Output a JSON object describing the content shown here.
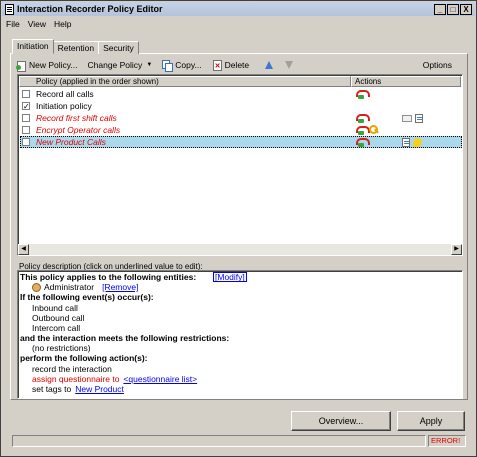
{
  "window": {
    "title": "Interaction Recorder Policy Editor",
    "controls": [
      "_",
      "□",
      "X"
    ]
  },
  "menu": [
    "File",
    "View",
    "Help"
  ],
  "tabs": [
    {
      "label": "Initiation",
      "active": true
    },
    {
      "label": "Retention",
      "active": false
    },
    {
      "label": "Security",
      "active": false
    }
  ],
  "toolbar": {
    "new_policy": "New Policy...",
    "change_policy": "Change Policy",
    "copy": "Copy...",
    "delete": "Delete",
    "options": "Options"
  },
  "list": {
    "headers": {
      "policy": "Policy (applied in the order shown)",
      "actions": "Actions"
    },
    "rows": [
      {
        "label": "Record all calls",
        "checked": false,
        "style": "normal",
        "icons": [
          "phone-icon"
        ]
      },
      {
        "label": "Initiation policy",
        "checked": true,
        "style": "normal",
        "icons": []
      },
      {
        "label": "Record first shift calls",
        "checked": false,
        "style": "red",
        "icons": [
          "phone-icon",
          "mail-icon",
          "note-icon"
        ]
      },
      {
        "label": "Encrypt Operator calls",
        "checked": false,
        "style": "red",
        "icons": [
          "phone-icon",
          "key-icon"
        ]
      },
      {
        "label": "New Product Calls",
        "checked": false,
        "style": "red",
        "selected": true,
        "icons": [
          "phone-icon",
          "note-icon",
          "tag-icon"
        ]
      }
    ],
    "check_glyph": "✓"
  },
  "description": {
    "label": "Policy description (click on underlined value to edit):",
    "applies_to": "This policy applies to the following entities:",
    "modify": "[Modify]",
    "entity": "Administrator",
    "remove": "[Remove]",
    "events_header": "If the following event(s) occur(s):",
    "events": [
      "Inbound call",
      "Outbound call",
      "Intercom call"
    ],
    "restrictions_header": "and the interaction meets the following restrictions:",
    "restrictions": "(no restrictions)",
    "actions_header": "perform the following action(s):",
    "action_record": "record the interaction",
    "action_questionnaire": "assign questionnaire to",
    "questionnaire_link": "<questionnaire list>",
    "action_tags": "set tags to",
    "tags_link": "New Product"
  },
  "buttons": {
    "overview": "Overview...",
    "apply": "Apply"
  },
  "status": {
    "error": "ERROR!"
  },
  "colors": {
    "error_red": "#e00000",
    "link_blue": "#0000ee",
    "selection": "#a9d9ea"
  }
}
